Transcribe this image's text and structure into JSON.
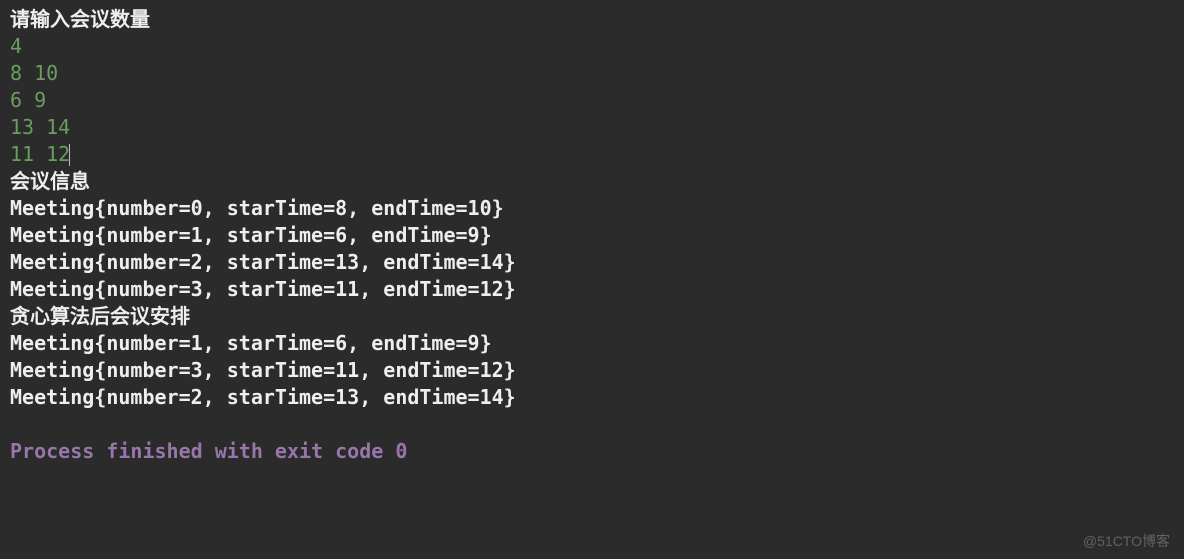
{
  "console": {
    "prompt": "请输入会议数量",
    "inputs": [
      "4",
      "8 10",
      "6 9",
      "13 14",
      "11 12"
    ],
    "section1_header": "会议信息",
    "meetings_info": [
      "Meeting{number=0, starTime=8, endTime=10}",
      "Meeting{number=1, starTime=6, endTime=9}",
      "Meeting{number=2, starTime=13, endTime=14}",
      "Meeting{number=3, starTime=11, endTime=12}"
    ],
    "section2_header": "贪心算法后会议安排",
    "greedy_result": [
      "Meeting{number=1, starTime=6, endTime=9}",
      "Meeting{number=3, starTime=11, endTime=12}",
      "Meeting{number=2, starTime=13, endTime=14}"
    ],
    "exit_message": "Process finished with exit code 0"
  },
  "watermark": "@51CTO博客"
}
